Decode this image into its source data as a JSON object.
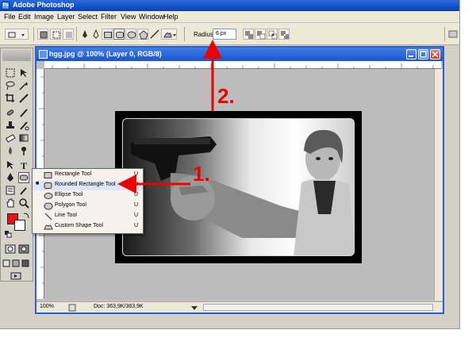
{
  "app": {
    "title": "Adobe Photoshop"
  },
  "menu": [
    "File",
    "Edit",
    "Image",
    "Layer",
    "Select",
    "Filter",
    "View",
    "Window",
    "Help"
  ],
  "options_bar": {
    "radius_label": "Radius:",
    "radius_value": "6 px",
    "selected_shape_tool": "rounded-rectangle"
  },
  "document": {
    "title": "hgg.jpg @ 100% (Layer 0, RGB/8)",
    "zoom": "100%",
    "doc_size": "Doc: 363,9K/363,9K"
  },
  "tool_flyout": {
    "items": [
      {
        "label": "Rectangle Tool",
        "shortcut": "U",
        "checked": false,
        "icon": "rectangle-icon"
      },
      {
        "label": "Rounded Rectangle Tool",
        "shortcut": "U",
        "checked": true,
        "icon": "rounded-rectangle-icon"
      },
      {
        "label": "Ellipse Tool",
        "shortcut": "U",
        "checked": false,
        "icon": "ellipse-icon"
      },
      {
        "label": "Polygon Tool",
        "shortcut": "U",
        "checked": false,
        "icon": "polygon-icon"
      },
      {
        "label": "Line Tool",
        "shortcut": "U",
        "checked": false,
        "icon": "line-icon"
      },
      {
        "label": "Custom Shape Tool",
        "shortcut": "U",
        "checked": false,
        "icon": "custom-shape-icon"
      }
    ],
    "check_mark": "■"
  },
  "annotations": {
    "step1": "1.",
    "step2": "2."
  },
  "colors": {
    "foreground": "#ee1111",
    "background": "#ffffff",
    "annotation": "#ee0000",
    "title_bar": "#1c54d0"
  }
}
